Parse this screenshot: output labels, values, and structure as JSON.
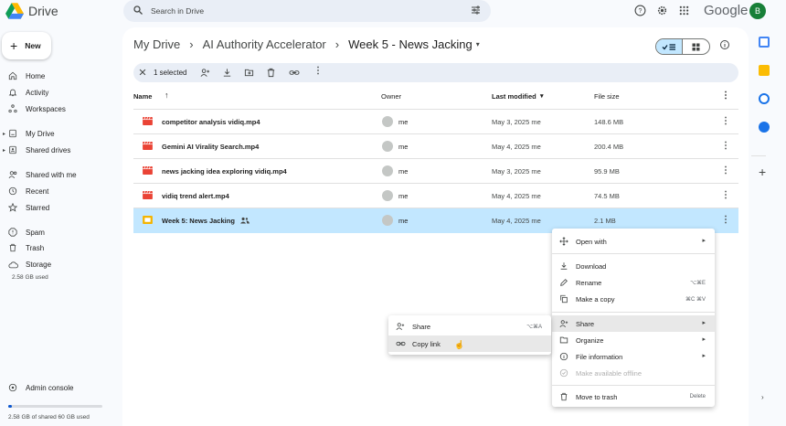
{
  "app": {
    "name": "Drive",
    "google_word": "Google",
    "avatar_letter": "B"
  },
  "search": {
    "placeholder": "Search in Drive"
  },
  "sidebar": {
    "new_label": "New",
    "items": [
      {
        "label": "Home",
        "icon": "home-icon"
      },
      {
        "label": "Activity",
        "icon": "bell-icon"
      },
      {
        "label": "Workspaces",
        "icon": "workspaces-icon"
      },
      {
        "label": "My Drive",
        "icon": "my-drive-icon"
      },
      {
        "label": "Shared drives",
        "icon": "shared-drives-icon"
      },
      {
        "label": "Shared with me",
        "icon": "people-icon"
      },
      {
        "label": "Recent",
        "icon": "clock-icon"
      },
      {
        "label": "Starred",
        "icon": "star-icon"
      },
      {
        "label": "Spam",
        "icon": "spam-icon"
      },
      {
        "label": "Trash",
        "icon": "trash-icon"
      },
      {
        "label": "Storage",
        "icon": "cloud-icon"
      }
    ],
    "storage_used": "2.58 GB used",
    "admin_console": "Admin console",
    "storage_shared": "2.58 GB of shared 60 GB used",
    "storage_fraction": 0.043
  },
  "breadcrumb": [
    "My Drive",
    "AI Authority Accelerator",
    "Week 5 - News Jacking"
  ],
  "selection": {
    "count_label": "1 selected"
  },
  "columns": {
    "name": "Name",
    "owner": "Owner",
    "modified": "Last modified",
    "size": "File size"
  },
  "files": [
    {
      "name": "competitor analysis vidiq.mp4",
      "owner": "me",
      "modified": "May 3, 2025 me",
      "size": "148.6 MB",
      "type": "video"
    },
    {
      "name": "Gemini AI Virality Search.mp4",
      "owner": "me",
      "modified": "May 4, 2025 me",
      "size": "200.4 MB",
      "type": "video"
    },
    {
      "name": "news jacking idea exploring vidiq.mp4",
      "owner": "me",
      "modified": "May 3, 2025 me",
      "size": "95.9 MB",
      "type": "video"
    },
    {
      "name": "vidiq trend alert.mp4",
      "owner": "me",
      "modified": "May 4, 2025 me",
      "size": "74.5 MB",
      "type": "video"
    },
    {
      "name": "Week 5: News Jacking",
      "owner": "me",
      "modified": "May 4, 2025 me",
      "size": "2.1 MB",
      "type": "slides"
    }
  ],
  "context_menu": [
    {
      "label": "Open with",
      "shortcut": "",
      "arrow": true
    },
    {
      "label": "Download",
      "shortcut": ""
    },
    {
      "label": "Rename",
      "shortcut": "⌥⌘E"
    },
    {
      "label": "Make a copy",
      "shortcut": "⌘C ⌘V"
    },
    {
      "label": "Share",
      "shortcut": "",
      "arrow": true
    },
    {
      "label": "Organize",
      "shortcut": "",
      "arrow": true
    },
    {
      "label": "File information",
      "shortcut": "",
      "arrow": true
    },
    {
      "label": "Make available offline",
      "shortcut": ""
    },
    {
      "label": "Move to trash",
      "shortcut": "Delete"
    }
  ],
  "share_submenu": [
    {
      "label": "Share",
      "shortcut": "⌥⌘A"
    },
    {
      "label": "Copy link",
      "shortcut": ""
    }
  ],
  "colors": {
    "accent": "#0b57d0",
    "selected_row": "#c2e7ff",
    "video_red": "#ea4335",
    "slides_yellow": "#f4b400"
  }
}
